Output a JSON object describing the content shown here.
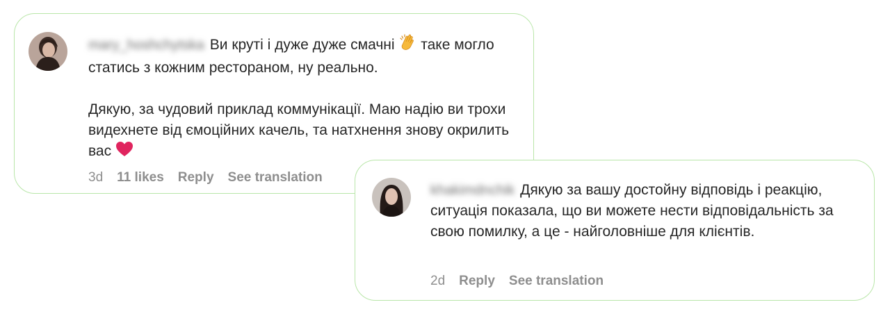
{
  "comments": [
    {
      "username": "mary_hoshchytska",
      "text_line1": "Ви круті і дуже дуже смачні",
      "text_line1_after_emoji": " таке могло статись з кожним рестораном, ну реально.",
      "text_paragraph2": "Дякую, за чудовий приклад коммунікації. Маю надію ви трохи видехнете від ємоційних качель, та натхнення знову окрилить вас",
      "emoji_1": "clapping-hands",
      "emoji_2": "red-heart",
      "time": "3d",
      "likes": "11 likes",
      "reply_label": "Reply",
      "translate_label": "See translation"
    },
    {
      "username": "khakimdnchik",
      "text": "Дякую за вашу достойну відповідь і реакцію, ситуація показала, що ви можете нести відповідальність за свою помилку, а це - найголовніше для клієнтів.",
      "time": "2d",
      "reply_label": "Reply",
      "translate_label": "See translation"
    }
  ],
  "colors": {
    "card_border": "#b8e6a8",
    "text": "#262626",
    "muted": "#8e8e8e",
    "heart": "#e0245e",
    "clap": "#f6b93b"
  }
}
